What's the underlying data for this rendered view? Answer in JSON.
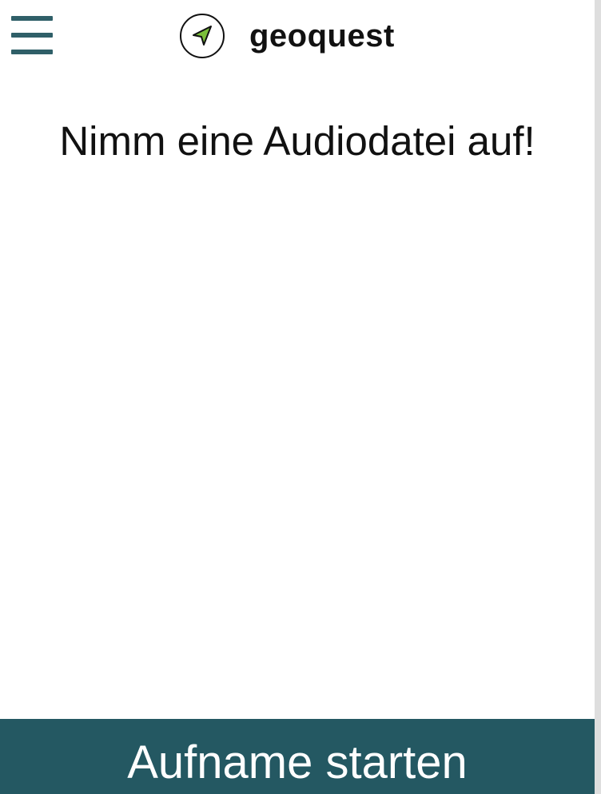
{
  "header": {
    "menu_icon": "hamburger-menu-icon",
    "logo_icon": "navigation-arrow-icon",
    "brand_name": "geoquest"
  },
  "main": {
    "prompt": "Nimm eine Audiodatei auf!"
  },
  "footer": {
    "record_button_label": "Aufname starten"
  },
  "colors": {
    "accent": "#245862",
    "menu_icon": "#2f5f68",
    "logo_arrow": "#7bbf3a",
    "text": "#111111",
    "background": "#ffffff"
  }
}
